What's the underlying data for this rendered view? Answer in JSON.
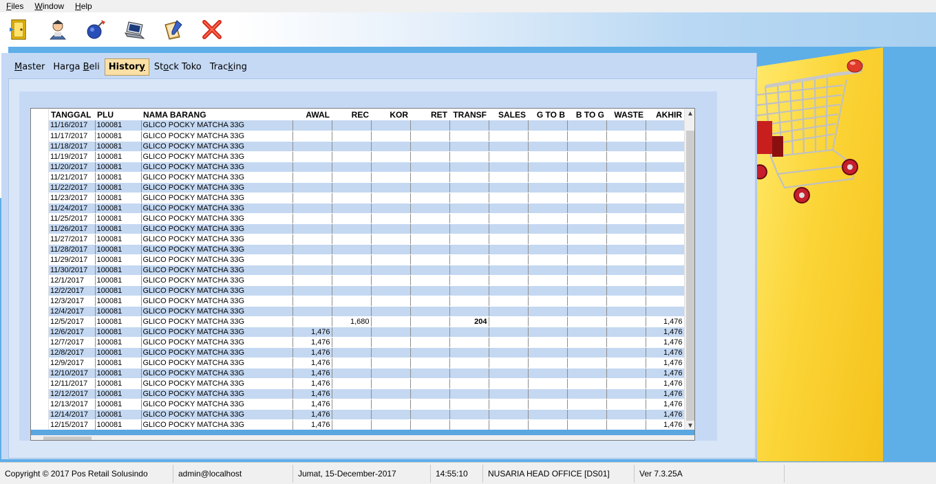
{
  "menu": {
    "items": [
      {
        "accel": "F",
        "rest": "iles"
      },
      {
        "accel": "W",
        "rest": "indow"
      },
      {
        "accel": "H",
        "rest": "elp"
      }
    ]
  },
  "toolbar": {
    "icons": [
      "door-exit-icon",
      "user-icon",
      "bomb-icon",
      "laptop-icon",
      "notebook-pen-icon",
      "close-icon"
    ]
  },
  "tabs": [
    {
      "label": "Master",
      "accel_index": 0,
      "active": false
    },
    {
      "label": "Harga Beli",
      "accel_index": 6,
      "active": false
    },
    {
      "label": "History",
      "accel_index": 6,
      "active": true
    },
    {
      "label": "Stock Toko",
      "accel_index": 2,
      "active": false
    },
    {
      "label": "Tracking",
      "accel_index": 4,
      "active": false
    }
  ],
  "grid": {
    "columns": [
      "TANGGAL",
      "PLU",
      "NAMA BARANG",
      "AWAL",
      "REC",
      "KOR",
      "RET",
      "TRANSF",
      "SALES",
      "G TO B",
      "B TO G",
      "WASTE",
      "AKHIR"
    ],
    "rows": [
      [
        "11/16/2017",
        "100081",
        "GLICO POCKY MATCHA 33G",
        "",
        "",
        "",
        "",
        "",
        "",
        "",
        "",
        "",
        ""
      ],
      [
        "11/17/2017",
        "100081",
        "GLICO POCKY MATCHA 33G",
        "",
        "",
        "",
        "",
        "",
        "",
        "",
        "",
        "",
        ""
      ],
      [
        "11/18/2017",
        "100081",
        "GLICO POCKY MATCHA 33G",
        "",
        "",
        "",
        "",
        "",
        "",
        "",
        "",
        "",
        ""
      ],
      [
        "11/19/2017",
        "100081",
        "GLICO POCKY MATCHA 33G",
        "",
        "",
        "",
        "",
        "",
        "",
        "",
        "",
        "",
        ""
      ],
      [
        "11/20/2017",
        "100081",
        "GLICO POCKY MATCHA 33G",
        "",
        "",
        "",
        "",
        "",
        "",
        "",
        "",
        "",
        ""
      ],
      [
        "11/21/2017",
        "100081",
        "GLICO POCKY MATCHA 33G",
        "",
        "",
        "",
        "",
        "",
        "",
        "",
        "",
        "",
        ""
      ],
      [
        "11/22/2017",
        "100081",
        "GLICO POCKY MATCHA 33G",
        "",
        "",
        "",
        "",
        "",
        "",
        "",
        "",
        "",
        ""
      ],
      [
        "11/23/2017",
        "100081",
        "GLICO POCKY MATCHA 33G",
        "",
        "",
        "",
        "",
        "",
        "",
        "",
        "",
        "",
        ""
      ],
      [
        "11/24/2017",
        "100081",
        "GLICO POCKY MATCHA 33G",
        "",
        "",
        "",
        "",
        "",
        "",
        "",
        "",
        "",
        ""
      ],
      [
        "11/25/2017",
        "100081",
        "GLICO POCKY MATCHA 33G",
        "",
        "",
        "",
        "",
        "",
        "",
        "",
        "",
        "",
        ""
      ],
      [
        "11/26/2017",
        "100081",
        "GLICO POCKY MATCHA 33G",
        "",
        "",
        "",
        "",
        "",
        "",
        "",
        "",
        "",
        ""
      ],
      [
        "11/27/2017",
        "100081",
        "GLICO POCKY MATCHA 33G",
        "",
        "",
        "",
        "",
        "",
        "",
        "",
        "",
        "",
        ""
      ],
      [
        "11/28/2017",
        "100081",
        "GLICO POCKY MATCHA 33G",
        "",
        "",
        "",
        "",
        "",
        "",
        "",
        "",
        "",
        ""
      ],
      [
        "11/29/2017",
        "100081",
        "GLICO POCKY MATCHA 33G",
        "",
        "",
        "",
        "",
        "",
        "",
        "",
        "",
        "",
        ""
      ],
      [
        "11/30/2017",
        "100081",
        "GLICO POCKY MATCHA 33G",
        "",
        "",
        "",
        "",
        "",
        "",
        "",
        "",
        "",
        ""
      ],
      [
        "12/1/2017",
        "100081",
        "GLICO POCKY MATCHA 33G",
        "",
        "",
        "",
        "",
        "",
        "",
        "",
        "",
        "",
        ""
      ],
      [
        "12/2/2017",
        "100081",
        "GLICO POCKY MATCHA 33G",
        "",
        "",
        "",
        "",
        "",
        "",
        "",
        "",
        "",
        ""
      ],
      [
        "12/3/2017",
        "100081",
        "GLICO POCKY MATCHA 33G",
        "",
        "",
        "",
        "",
        "",
        "",
        "",
        "",
        "",
        ""
      ],
      [
        "12/4/2017",
        "100081",
        "GLICO POCKY MATCHA 33G",
        "",
        "",
        "",
        "",
        "",
        "",
        "",
        "",
        "",
        ""
      ],
      [
        "12/5/2017",
        "100081",
        "GLICO POCKY MATCHA 33G",
        "",
        "1,680",
        "",
        "",
        "204",
        "",
        "",
        "",
        "",
        "1,476"
      ],
      [
        "12/6/2017",
        "100081",
        "GLICO POCKY MATCHA 33G",
        "1,476",
        "",
        "",
        "",
        "",
        "",
        "",
        "",
        "",
        "1,476"
      ],
      [
        "12/7/2017",
        "100081",
        "GLICO POCKY MATCHA 33G",
        "1,476",
        "",
        "",
        "",
        "",
        "",
        "",
        "",
        "",
        "1,476"
      ],
      [
        "12/8/2017",
        "100081",
        "GLICO POCKY MATCHA 33G",
        "1,476",
        "",
        "",
        "",
        "",
        "",
        "",
        "",
        "",
        "1,476"
      ],
      [
        "12/9/2017",
        "100081",
        "GLICO POCKY MATCHA 33G",
        "1,476",
        "",
        "",
        "",
        "",
        "",
        "",
        "",
        "",
        "1,476"
      ],
      [
        "12/10/2017",
        "100081",
        "GLICO POCKY MATCHA 33G",
        "1,476",
        "",
        "",
        "",
        "",
        "",
        "",
        "",
        "",
        "1,476"
      ],
      [
        "12/11/2017",
        "100081",
        "GLICO POCKY MATCHA 33G",
        "1,476",
        "",
        "",
        "",
        "",
        "",
        "",
        "",
        "",
        "1,476"
      ],
      [
        "12/12/2017",
        "100081",
        "GLICO POCKY MATCHA 33G",
        "1,476",
        "",
        "",
        "",
        "",
        "",
        "",
        "",
        "",
        "1,476"
      ],
      [
        "12/13/2017",
        "100081",
        "GLICO POCKY MATCHA 33G",
        "1,476",
        "",
        "",
        "",
        "",
        "",
        "",
        "",
        "",
        "1,476"
      ],
      [
        "12/14/2017",
        "100081",
        "GLICO POCKY MATCHA 33G",
        "1,476",
        "",
        "",
        "",
        "",
        "",
        "",
        "",
        "",
        "1,476"
      ],
      [
        "12/15/2017",
        "100081",
        "GLICO POCKY MATCHA 33G",
        "1,476",
        "",
        "",
        "",
        "",
        "",
        "",
        "",
        "",
        "1,476"
      ]
    ]
  },
  "status": {
    "copyright": "Copyright © 2017 Pos Retail Solusindo",
    "user": "admin@localhost",
    "date": "Jumat, 15-December-2017",
    "time": "14:55:10",
    "office": "NUSARIA HEAD OFFICE [DS01]",
    "version": "Ver 7.3.25A"
  },
  "colors": {
    "desktop": "#5eaee8",
    "row_alt": "#c4d8f2",
    "active_tab": "#fbe0a6",
    "banner": "#fbd436"
  }
}
